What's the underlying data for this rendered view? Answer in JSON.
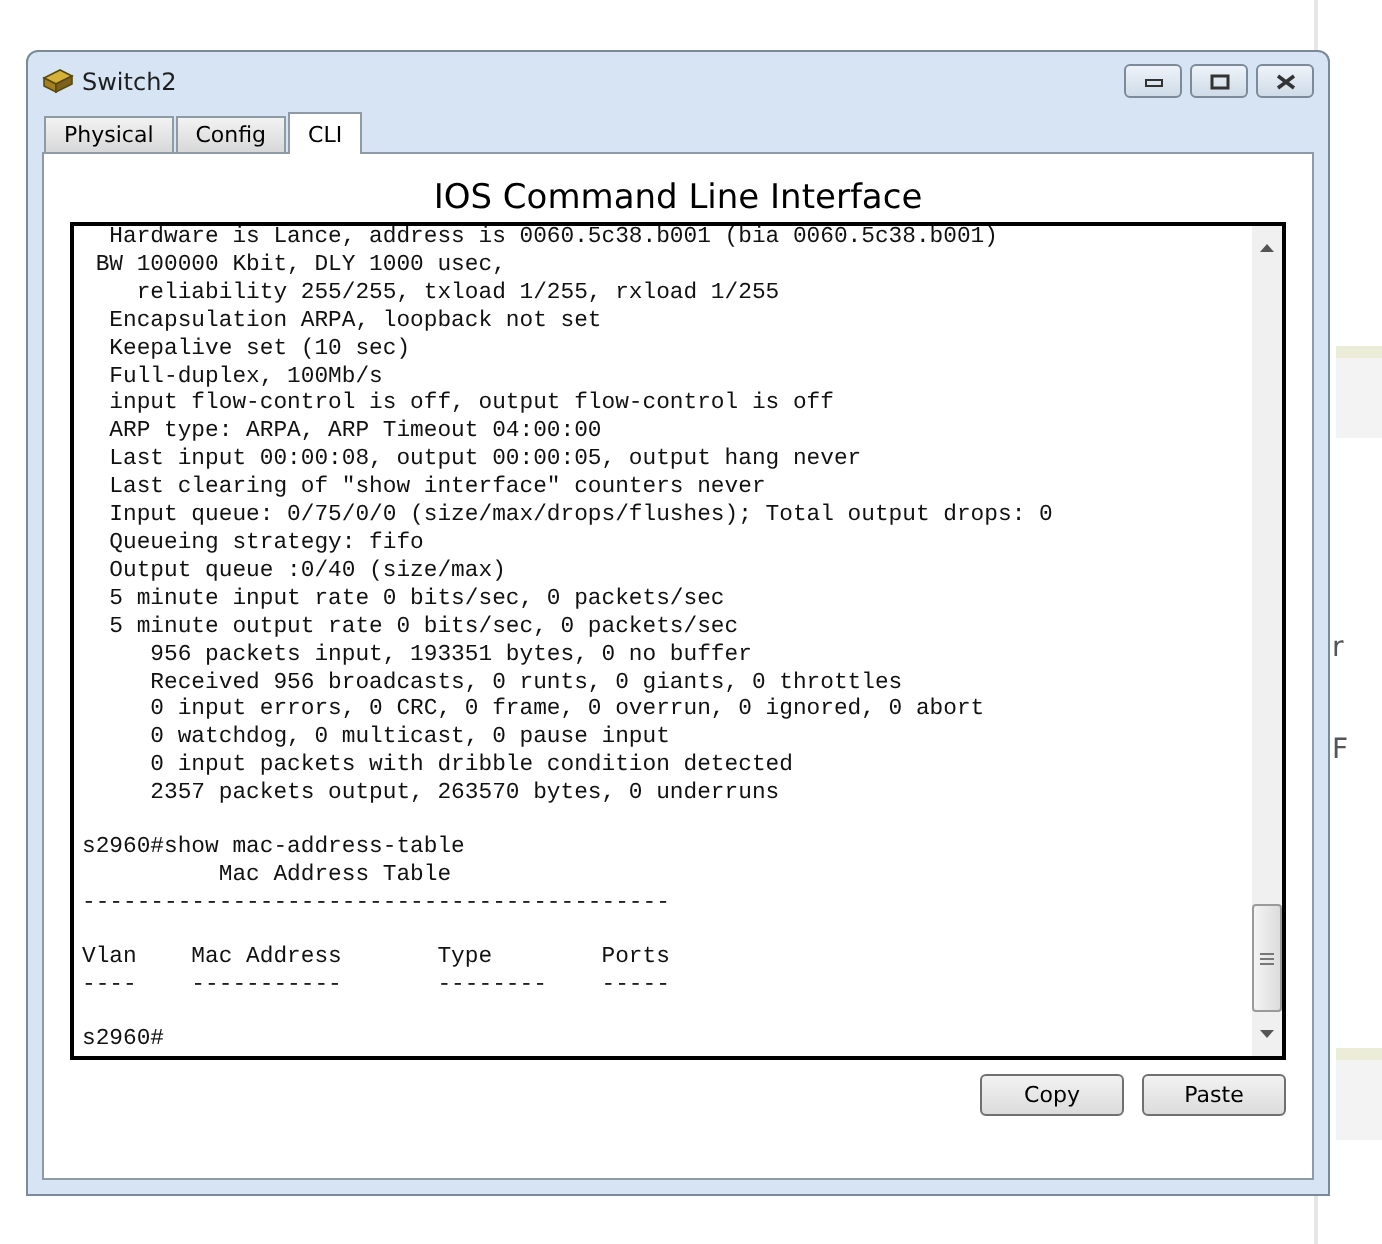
{
  "window": {
    "title": "Switch2"
  },
  "tabs": [
    {
      "label": "Physical",
      "selected": false
    },
    {
      "label": "Config",
      "selected": false
    },
    {
      "label": "CLI",
      "selected": true
    }
  ],
  "heading": "IOS Command Line Interface",
  "terminal": {
    "blocks": [
      [
        "  Hardware is Lance, address is 0060.5c38.b001 (bia 0060.5c38.b001)",
        " BW 100000 Kbit, DLY 1000 usec,",
        "    reliability 255/255, txload 1/255, rxload 1/255",
        "  Encapsulation ARPA, loopback not set",
        "  Keepalive set (10 sec)",
        "  Full-duplex, 100Mb/s",
        "  input flow-control is off, output flow-control is off",
        "  ARP type: ARPA, ARP Timeout 04:00:00",
        "  Last input 00:00:08, output 00:00:05, output hang never",
        "  Last clearing of \"show interface\" counters never",
        "  Input queue: 0/75/0/0 (size/max/drops/flushes); Total output drops: 0",
        "  Queueing strategy: fifo",
        "  Output queue :0/40 (size/max)",
        "  5 minute input rate 0 bits/sec, 0 packets/sec",
        "  5 minute output rate 0 bits/sec, 0 packets/sec",
        "     956 packets input, 193351 bytes, 0 no buffer",
        "     Received 956 broadcasts, 0 runts, 0 giants, 0 throttles",
        "     0 input errors, 0 CRC, 0 frame, 0 overrun, 0 ignored, 0 abort",
        "     0 watchdog, 0 multicast, 0 pause input",
        "     0 input packets with dribble condition detected",
        "     2357 packets output, 263570 bytes, 0 underruns"
      ],
      [
        "s2960#show mac-address-table",
        "          Mac Address Table",
        "-------------------------------------------"
      ],
      [
        "Vlan    Mac Address       Type        Ports",
        "----    -----------       --------    -----"
      ],
      [
        "s2960#"
      ]
    ]
  },
  "buttons": [
    "Copy",
    "Paste"
  ],
  "background_fragments": [
    "r",
    "F"
  ]
}
